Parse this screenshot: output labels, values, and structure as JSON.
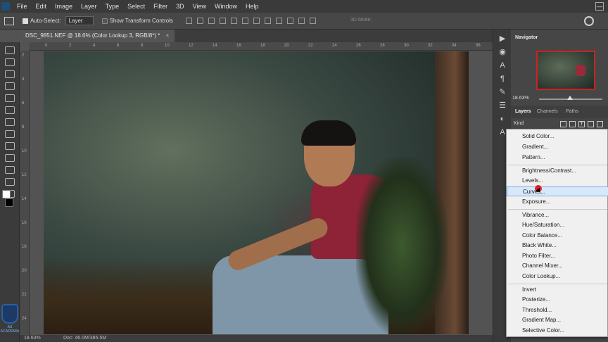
{
  "menubar": {
    "items": [
      "File",
      "Edit",
      "Image",
      "Layer",
      "Type",
      "Select",
      "Filter",
      "3D",
      "View",
      "Window",
      "Help"
    ],
    "minimize": "—"
  },
  "options": {
    "auto_select": "Auto-Select:",
    "auto_select_target": "Layer",
    "show_transform": "Show Transform Controls",
    "mode_3d": "3D Mode:"
  },
  "document": {
    "tab_title": "DSC_9851.NEF @ 18.6% (Color Lookup 3, RGB/8*) *",
    "close": "×",
    "zoom": "18.63%",
    "doc_size": "Doc: 46.0M/385.5M"
  },
  "ruler": {
    "top_marks": [
      "0",
      "2",
      "4",
      "6",
      "8",
      "10",
      "12",
      "14",
      "16",
      "18",
      "20",
      "22",
      "24",
      "26",
      "28",
      "30",
      "32",
      "34",
      "36"
    ],
    "left_marks": [
      "2",
      "4",
      "6",
      "8",
      "10",
      "12",
      "14",
      "16",
      "18",
      "20",
      "22",
      "24"
    ]
  },
  "toolbar": {
    "logo_text": "AS ACADEMIA"
  },
  "navigator": {
    "title": "Navigator",
    "zoom": "18.63%"
  },
  "layers": {
    "tabs": [
      "Layers",
      "Channels",
      "Paths"
    ],
    "filter": "Kind"
  },
  "adjustment_menu": {
    "groups": [
      [
        "Solid Color...",
        "Gradient...",
        "Pattern..."
      ],
      [
        "Brightness/Contrast...",
        "Levels...",
        "Curves...",
        "Exposure..."
      ],
      [
        "Vibrance...",
        "Hue/Saturation...",
        "Color Balance...",
        "Black  White...",
        "Photo Filter...",
        "Channel Mixer...",
        "Color Lookup..."
      ],
      [
        "Invert",
        "Posterize...",
        "Threshold...",
        "Gradient Map...",
        "Selective Color..."
      ]
    ],
    "highlighted": "Curves..."
  }
}
